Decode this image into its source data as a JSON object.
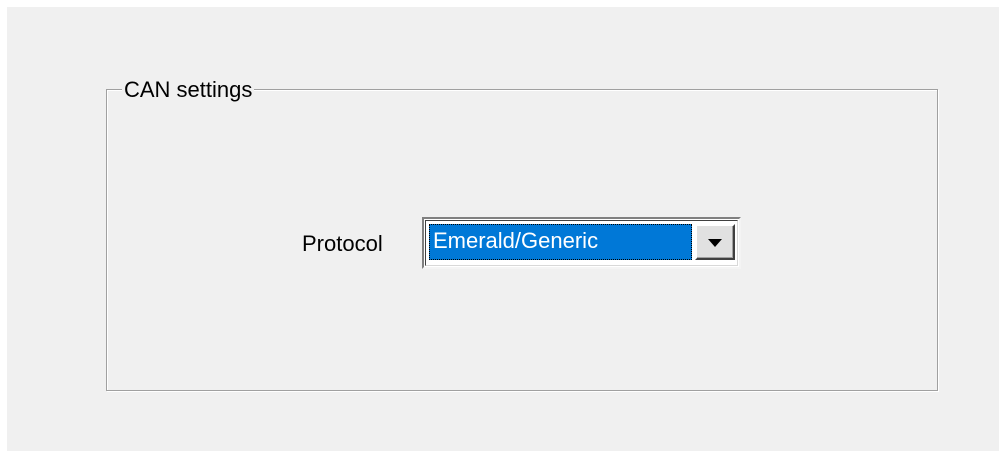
{
  "groupbox": {
    "title": "CAN settings"
  },
  "protocol": {
    "label": "Protocol",
    "selected_value": "Emerald/Generic",
    "dropdown_icon": "chevron-down-icon"
  },
  "colors": {
    "window_background": "#f0f0f0",
    "selection_highlight": "#0078d7",
    "selection_text": "#ffffff",
    "groupbox_border": "#a0a0a0"
  }
}
